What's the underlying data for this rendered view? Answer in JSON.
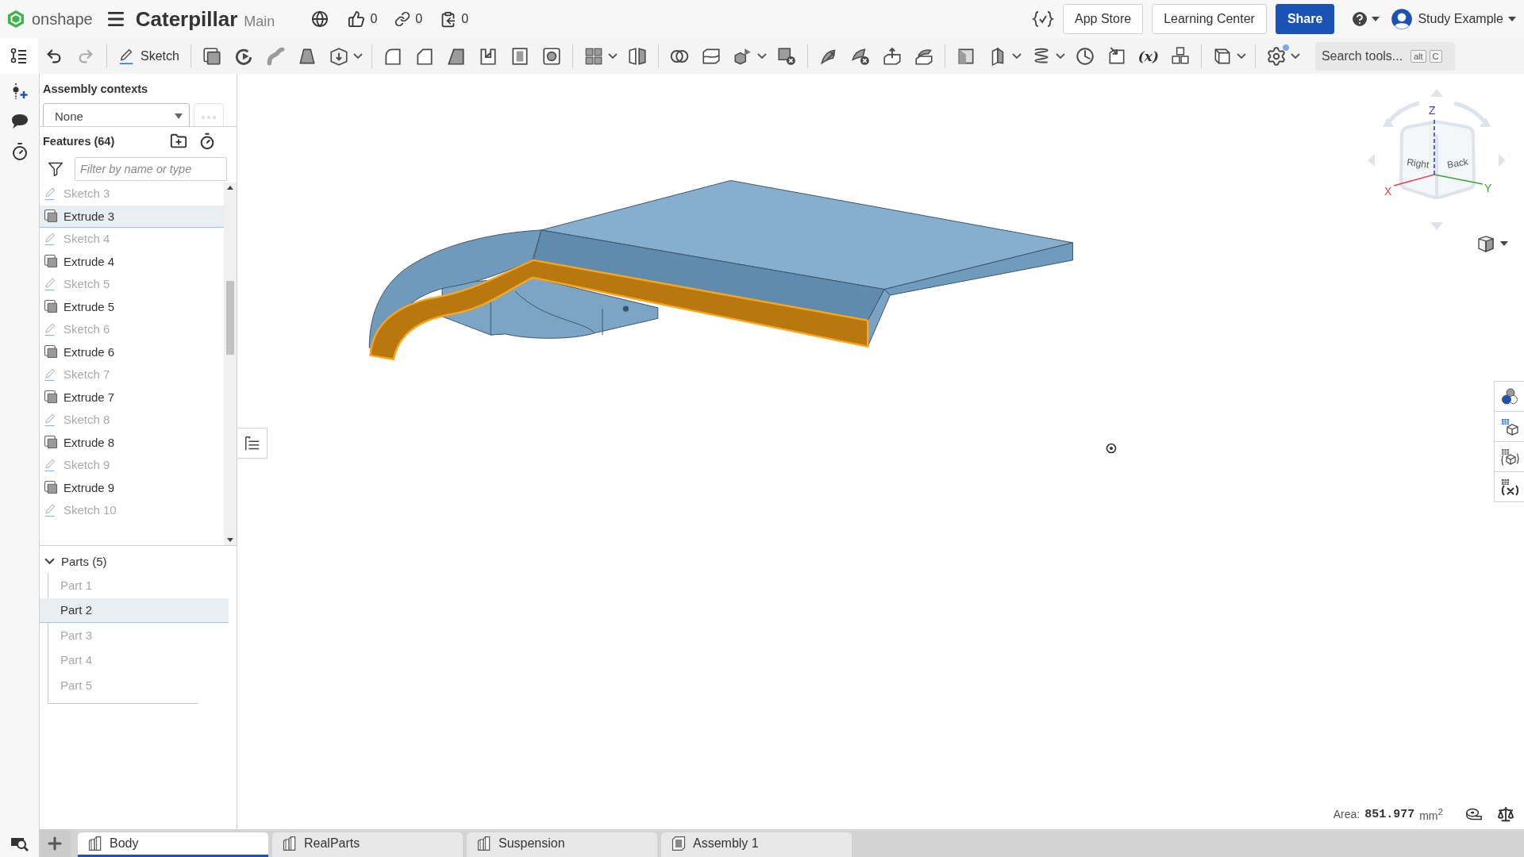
{
  "top_bar": {
    "logo_text": "onshape",
    "document_title": "Caterpillar",
    "workspace": "Main",
    "counters": [
      {
        "kind": "likes",
        "value": "0"
      },
      {
        "kind": "links",
        "value": "0"
      },
      {
        "kind": "copies",
        "value": "0"
      }
    ],
    "buttons": [
      {
        "label": "App Store",
        "kind": "outline"
      },
      {
        "label": "Learning Center",
        "kind": "outline"
      },
      {
        "label": "Share",
        "kind": "primary"
      }
    ],
    "user_name": "Study Example"
  },
  "toolbar": {
    "sketch_label": "Sketch",
    "variable_label": "(x)",
    "search": {
      "placeholder": "Search tools...",
      "keys": [
        "alt",
        "C"
      ]
    }
  },
  "feature_panel": {
    "assembly_contexts": {
      "title": "Assembly contexts",
      "value": "None"
    },
    "features": {
      "title": "Features (64)",
      "filter_placeholder": "Filter by name or type",
      "items": [
        {
          "label": "Sketch 3",
          "kind": "sketch",
          "hidden": true,
          "selected": false
        },
        {
          "label": "Extrude 3",
          "kind": "extrude",
          "hidden": false,
          "selected": true
        },
        {
          "label": "Sketch 4",
          "kind": "sketch",
          "hidden": true,
          "selected": false
        },
        {
          "label": "Extrude 4",
          "kind": "extrude",
          "hidden": false,
          "selected": false
        },
        {
          "label": "Sketch 5",
          "kind": "sketch",
          "hidden": true,
          "selected": false
        },
        {
          "label": "Extrude 5",
          "kind": "extrude",
          "hidden": false,
          "selected": false
        },
        {
          "label": "Sketch 6",
          "kind": "sketch",
          "hidden": true,
          "selected": false
        },
        {
          "label": "Extrude 6",
          "kind": "extrude",
          "hidden": false,
          "selected": false
        },
        {
          "label": "Sketch 7",
          "kind": "sketch",
          "hidden": true,
          "selected": false
        },
        {
          "label": "Extrude 7",
          "kind": "extrude",
          "hidden": false,
          "selected": false
        },
        {
          "label": "Sketch 8",
          "kind": "sketch",
          "hidden": true,
          "selected": false
        },
        {
          "label": "Extrude 8",
          "kind": "extrude",
          "hidden": false,
          "selected": false
        },
        {
          "label": "Sketch 9",
          "kind": "sketch",
          "hidden": true,
          "selected": false
        },
        {
          "label": "Extrude 9",
          "kind": "extrude",
          "hidden": false,
          "selected": false
        },
        {
          "label": "Sketch 10",
          "kind": "sketch",
          "hidden": true,
          "selected": false
        }
      ]
    },
    "parts": {
      "title": "Parts (5)",
      "expanded": true,
      "items": [
        {
          "label": "Part 1",
          "hidden": true,
          "selected": false
        },
        {
          "label": "Part 2",
          "hidden": false,
          "selected": true
        },
        {
          "label": "Part 3",
          "hidden": true,
          "selected": false
        },
        {
          "label": "Part 4",
          "hidden": true,
          "selected": false
        },
        {
          "label": "Part 5",
          "hidden": true,
          "selected": false
        }
      ]
    }
  },
  "view_cube": {
    "faces": [
      "Right",
      "Back"
    ],
    "axes": [
      {
        "label": "X",
        "color": "#e0474c"
      },
      {
        "label": "Y",
        "color": "#3aa53a"
      },
      {
        "label": "Z",
        "color": "#3b3bd6"
      }
    ]
  },
  "measurement": {
    "label": "Area:",
    "value": "851.977",
    "unit": "mm$^{2}$"
  },
  "tabs": [
    {
      "label": "Body",
      "kind": "part_studio",
      "selected": true
    },
    {
      "label": "RealParts",
      "kind": "part_studio",
      "selected": false
    },
    {
      "label": "Suspension",
      "kind": "part_studio",
      "selected": false
    },
    {
      "label": "Assembly 1",
      "kind": "assembly",
      "selected": false
    }
  ]
}
